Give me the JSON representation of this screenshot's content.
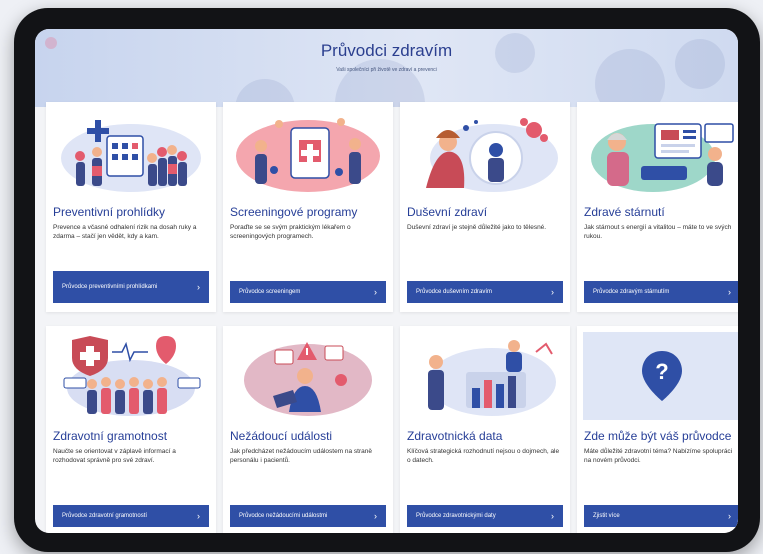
{
  "header": {
    "title": "Průvodci zdravím",
    "subtitle": "Vaši společníci při životě ve zdraví a prevenci"
  },
  "cards": [
    {
      "title": "Preventivní prohlídky",
      "desc": "Prevence a včasné odhalení rizik na dosah ruky a zdarma – stačí jen vědět, kdy a kam.",
      "button": "Průvodce preventivními prohlídkami"
    },
    {
      "title": "Screeningové programy",
      "desc": "Poraďte se se svým praktickým lékařem o screeningových programech.",
      "button": "Průvodce screeningem"
    },
    {
      "title": "Duševní zdraví",
      "desc": "Duševní zdraví je stejně důležité jako to tělesné.",
      "button": "Průvodce duševním zdravím"
    },
    {
      "title": "Zdravé stárnutí",
      "desc": "Jak stárnout s energií a vitalitou – máte to ve svých rukou.",
      "button": "Průvodce zdravým stárnutím"
    },
    {
      "title": "Zdravotní gramotnost",
      "desc": "Naučte se orientovat v záplavě informací a rozhodovat správně pro své zdraví.",
      "button": "Průvodce zdravotní gramotností"
    },
    {
      "title": "Nežádoucí události",
      "desc": "Jak předcházet nežádoucím událostem na straně personálu i pacientů.",
      "button": "Průvodce nežádoucími událostmi"
    },
    {
      "title": "Zdravotnická data",
      "desc": "Klíčová strategická rozhodnutí nejsou o dojmech, ale o datech.",
      "button": "Průvodce zdravotnickými daty"
    },
    {
      "title": "Zde může být váš průvodce",
      "desc": "Máte důležité zdravotní téma? Nabízíme spolupráci na novém průvodci.",
      "button": "Zjistit více"
    }
  ],
  "icons": {
    "arrow": "›",
    "help": "question-pin-icon"
  },
  "colors": {
    "accent": "#2f4fa6",
    "title": "#263e97",
    "header_bg": "#d3ddf1"
  }
}
